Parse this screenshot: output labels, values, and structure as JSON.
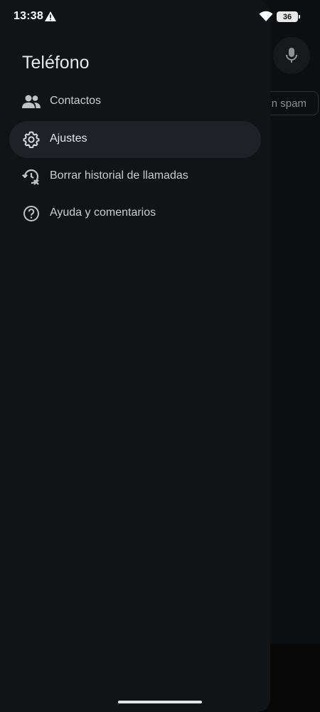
{
  "status_bar": {
    "time": "13:38",
    "battery": "36"
  },
  "background": {
    "chip_label": "n spam"
  },
  "drawer": {
    "title": "Teléfono",
    "items": [
      {
        "label": "Contactos",
        "icon": "contacts-icon",
        "selected": false
      },
      {
        "label": "Ajustes",
        "icon": "settings-gear-icon",
        "selected": true
      },
      {
        "label": "Borrar historial de llamadas",
        "icon": "clear-history-icon",
        "selected": false
      },
      {
        "label": "Ayuda y comentarios",
        "icon": "help-icon",
        "selected": false
      }
    ]
  },
  "colors": {
    "drawer_bg": "#111417",
    "selected_item_bg": "#1e2227",
    "text_primary": "#e6e7e9",
    "icon_color": "#bfc2c6"
  }
}
